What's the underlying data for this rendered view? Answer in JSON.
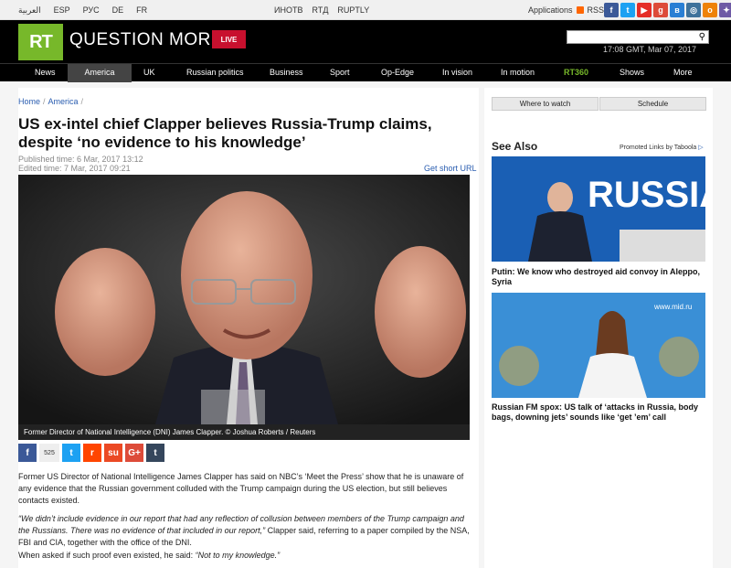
{
  "topbar": {
    "langs": [
      "العربية",
      "ESP",
      "РУС",
      "DE",
      "FR"
    ],
    "channels": [
      "ИНОТВ",
      "RTД",
      "RUPTLY"
    ],
    "applications": "Applications",
    "rss": "RSS"
  },
  "header": {
    "logo": "RT",
    "tagline": "QUESTION MORE",
    "live": "LIVE",
    "time": "17:08 GMT, Mar 07, 2017"
  },
  "nav": [
    "News",
    "America",
    "UK",
    "Russian politics",
    "Business",
    "Sport",
    "Op-Edge",
    "In vision",
    "In motion",
    "RT360",
    "Shows",
    "More"
  ],
  "breadcrumb": [
    "Home",
    "America"
  ],
  "article": {
    "title": "US ex-intel chief Clapper believes Russia-Trump claims, despite ‘no evidence to his knowledge’",
    "published": "Published time: 6 Mar, 2017 13:12",
    "edited": "Edited time: 7 Mar, 2017 09:21",
    "short_url": "Get short URL",
    "caption": "Former Director of National Intelligence (DNI) James Clapper. © Joshua Roberts / Reuters",
    "share_count": "525",
    "p1": "Former US Director of National Intelligence James Clapper has said on NBC’s ‘Meet the Press’ show that he is unaware of any evidence that the Russian government colluded with the Trump campaign during the US election, but still believes contacts existed.",
    "p2_quote": "“We didn’t include evidence in our report that had any reflection of collusion between members of the Trump campaign and the Russians. There was no evidence of that included in our report,”",
    "p2_rest": " Clapper said, referring to a paper compiled by the NSA, FBI and CIA, together with the office of the DNI.",
    "p3_start": "When asked if such proof even existed, he said: ",
    "p3_quote": "“Not to my knowledge.”"
  },
  "sidebar": {
    "where_to_watch": "Where to watch",
    "schedule": "Schedule",
    "see_also": "See Also",
    "taboola": "Promoted Links by Taboola",
    "stories": [
      {
        "title": "Putin: We know who destroyed aid convoy in Aleppo, Syria",
        "banner": "RUSSIA"
      },
      {
        "title": "Russian FM spox: US talk of ‘attacks in Russia, body bags, downing jets’ sounds like ‘get ’em’ call",
        "banner": "www.mid.ru"
      }
    ]
  },
  "colors": {
    "brand_green": "#77b82a",
    "live_red": "#c8102e",
    "link_blue": "#2a5db0"
  }
}
